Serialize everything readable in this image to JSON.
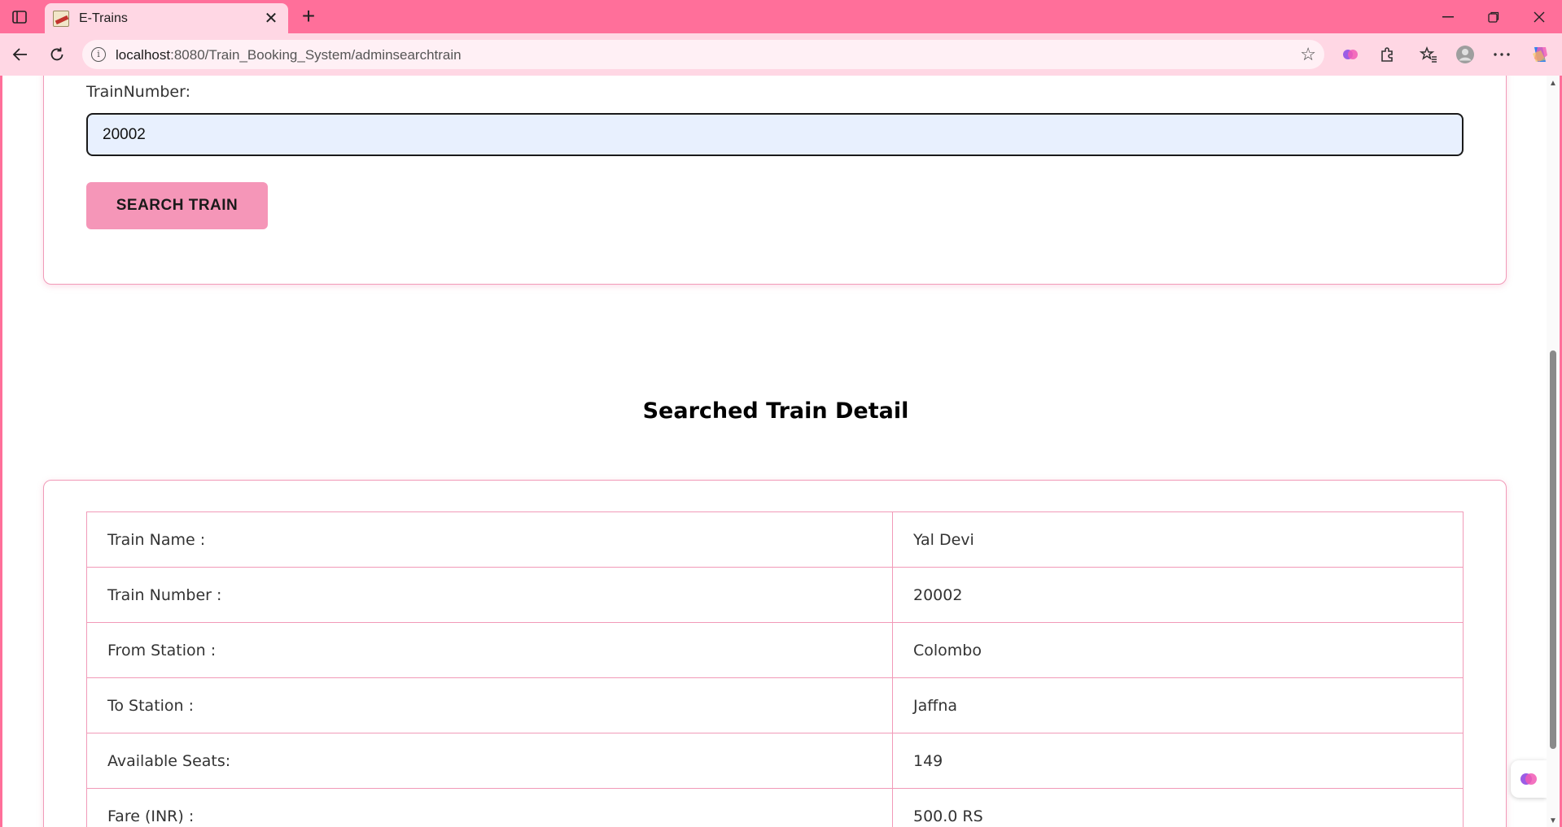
{
  "browser": {
    "tab_title": "E-Trains",
    "url_host": "localhost",
    "url_rest": ":8080/Train_Booking_System/adminsearchtrain",
    "icons": {
      "sidebar": "sidebar-toggle-icon",
      "favicon": "train-favicon-icon",
      "close": "close-icon",
      "new_tab": "plus-icon",
      "back": "back-arrow-icon",
      "reload": "reload-icon",
      "info": "info-icon",
      "favorite": "star-icon",
      "extensions": "puzzle-icon",
      "favorites": "favorites-list-icon",
      "profile": "profile-icon",
      "menu": "more-icon",
      "copilot": "copilot-icon"
    },
    "theme_color": "#ff6f9a"
  },
  "search_form": {
    "label": "TrainNumber:",
    "value": "20002",
    "button_label": "SEARCH TRAIN"
  },
  "results": {
    "title": "Searched Train Detail",
    "rows": [
      {
        "key": "Train Name :",
        "value": "Yal Devi"
      },
      {
        "key": "Train Number :",
        "value": "20002"
      },
      {
        "key": "From Station :",
        "value": "Colombo"
      },
      {
        "key": "To Station :",
        "value": "Jaffna"
      },
      {
        "key": "Available Seats:",
        "value": "149"
      },
      {
        "key": "Fare (INR) :",
        "value": "500.0 RS"
      }
    ]
  },
  "colors": {
    "accent_pink": "#f596b8",
    "border_pink": "#f19ab8",
    "input_bg": "#e8f0fe"
  }
}
